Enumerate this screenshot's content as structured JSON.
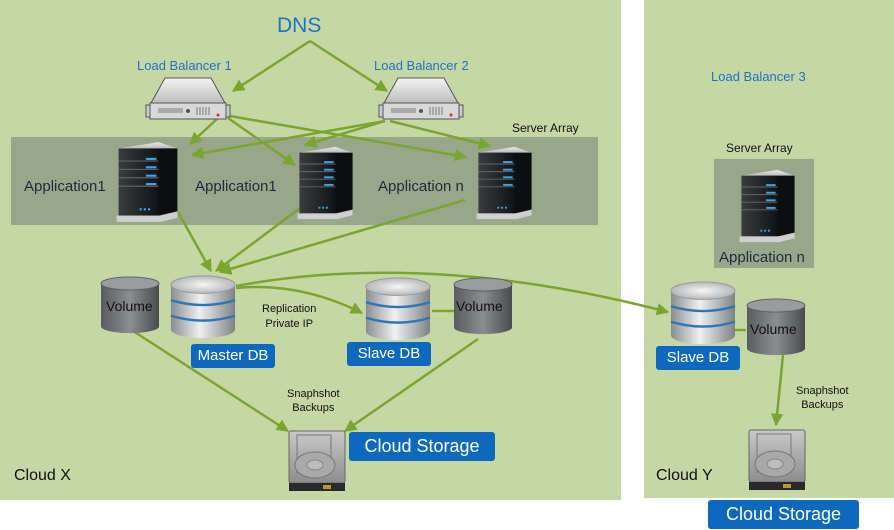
{
  "title": "DNS",
  "clouds": [
    {
      "id": "cloud-x",
      "label": "Cloud X"
    },
    {
      "id": "cloud-y",
      "label": "Cloud Y"
    }
  ],
  "load_balancers": [
    "Load Balancer 1",
    "Load Balancer 2",
    "Load Balancer 3"
  ],
  "server_arrays": {
    "label": "Server Array",
    "cloud_x_apps": [
      "Application1",
      "Application1",
      "Application n"
    ],
    "cloud_y_apps": [
      "Application n"
    ]
  },
  "databases": {
    "master": "Master DB",
    "slave_x": "Slave DB",
    "slave_y": "Slave DB"
  },
  "volume_label": "Volume",
  "replication_label": [
    "Replication",
    "Private IP"
  ],
  "snapshot_label": [
    "Snaphshot",
    "Backups"
  ],
  "storage_label": "Cloud Storage",
  "colors": {
    "panel_green": "#c6d7a6",
    "array_gray": "#98a78a",
    "arrow_green": "#7aa62e",
    "label_blue": "#0d69bd",
    "title_blue": "#1f74c2"
  }
}
